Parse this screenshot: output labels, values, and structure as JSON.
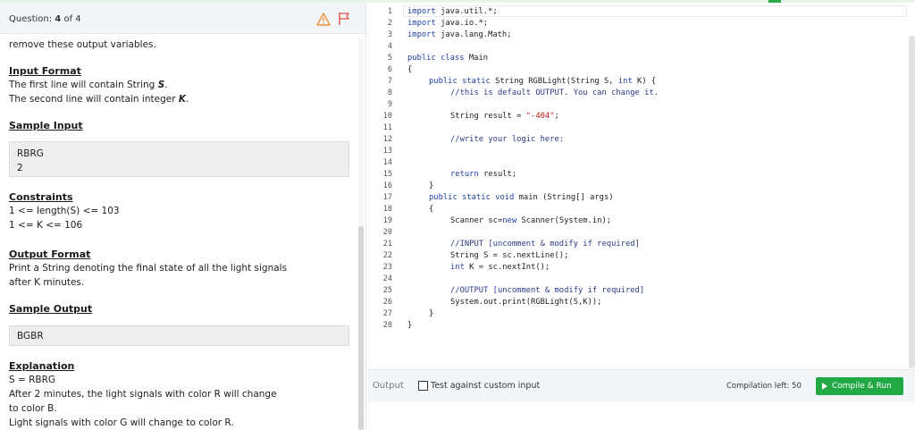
{
  "question": {
    "prefix": "Question:",
    "number": "4",
    "suffix": "of 4"
  },
  "problem": {
    "intro": "remove these output variables.",
    "input_format_heading": "Input Format",
    "input_line1_a": "The first line will contain String ",
    "input_line1_var": "S",
    "input_line1_b": ".",
    "input_line2_a": "The second line will contain integer ",
    "input_line2_var": "K",
    "input_line2_b": ".",
    "sample_input_heading": "Sample Input",
    "sample_input": [
      "RBRG",
      "2"
    ],
    "constraints_heading": "Constraints",
    "constraints": [
      "1 <= length(S) <= 103",
      "1 <= K <= 106"
    ],
    "output_format_heading": "Output Format",
    "output_format": [
      "Print a String denoting the final state of all the light signals",
      "after K minutes."
    ],
    "sample_output_heading": "Sample Output",
    "sample_output": "BGBR",
    "explanation_heading": "Explanation",
    "explanation": [
      "S = RBRG",
      "After 2 minutes, the light signals with color R will change",
      "to color B.",
      "Light signals with color G will change to color R."
    ]
  },
  "editor": {
    "line_numbers": [
      "1",
      "2",
      "3",
      "4",
      "5",
      "6",
      "7",
      "8",
      "9",
      "10",
      "11",
      "12",
      "13",
      "14",
      "15",
      "16",
      "17",
      "18",
      "19",
      "20",
      "21",
      "22",
      "23",
      "24",
      "25",
      "26",
      "27",
      "28"
    ],
    "l1_kw": "import",
    "l1_rest": " java.util.*;",
    "l2_kw": "import",
    "l2_rest": " java.io.*;",
    "l3_kw": "import",
    "l3_rest": " java.lang.Math;",
    "l5_kw": "public class",
    "l5_rest": " Main",
    "l6": "{",
    "l7_kw1": "public static",
    "l7_mid": " String RGBLight(String S, ",
    "l7_kw2": "int",
    "l7_rest": " K) {",
    "l8": "//this is default OUTPUT. You can change it.",
    "l10_a": "String result = ",
    "l10_str": "\"-404\"",
    "l10_b": ";",
    "l12": "//write your logic here:",
    "l15_kw": "return",
    "l15_rest": " result;",
    "l16": "}",
    "l17_kw": "public static void",
    "l17_rest": " main (String[] args)",
    "l18": "{",
    "l19_a": "Scanner sc=",
    "l19_kw": "new",
    "l19_b": " Scanner(System.in);",
    "l21": "//INPUT [uncomment & modify if required]",
    "l22": "String S = sc.nextLine();",
    "l23_kw": "int",
    "l23_rest": " K = sc.nextInt();",
    "l25": "//OUTPUT [uncomment & modify if required]",
    "l26": "System.out.print(RGBLight(S,K));",
    "l27": "}",
    "l28": "}"
  },
  "bottom_bar": {
    "output_label": "Output",
    "custom_input_label": "Test against custom input",
    "compilation_left": "Compilation left: 50",
    "compile_run": "Compile & Run"
  },
  "colors": {
    "accent_green": "#22a845",
    "warning_orange": "#e8913a",
    "flag_red": "#e0504a"
  }
}
